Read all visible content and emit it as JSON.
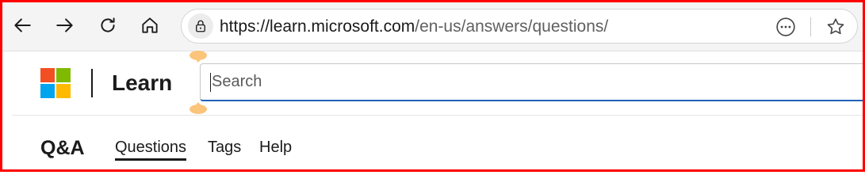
{
  "browser": {
    "url_host": "https://learn.microsoft.com",
    "url_path": "/en-us/answers/questions/",
    "icons": {
      "back": "arrow-left-icon",
      "forward": "arrow-right-icon",
      "refresh": "refresh-icon",
      "home": "home-icon",
      "site_info": "lock-icon",
      "more": "more-options-icon",
      "favorite": "star-icon"
    }
  },
  "header": {
    "brand": "Learn",
    "search_placeholder": "Search",
    "logo_colors": [
      "#f25022",
      "#7fba00",
      "#00a4ef",
      "#ffb900"
    ],
    "accent": "#1f62b8"
  },
  "subnav": {
    "title": "Q&A",
    "links": [
      {
        "label": "Questions",
        "active": true
      },
      {
        "label": "Tags",
        "active": false
      },
      {
        "label": "Help",
        "active": false
      }
    ]
  }
}
